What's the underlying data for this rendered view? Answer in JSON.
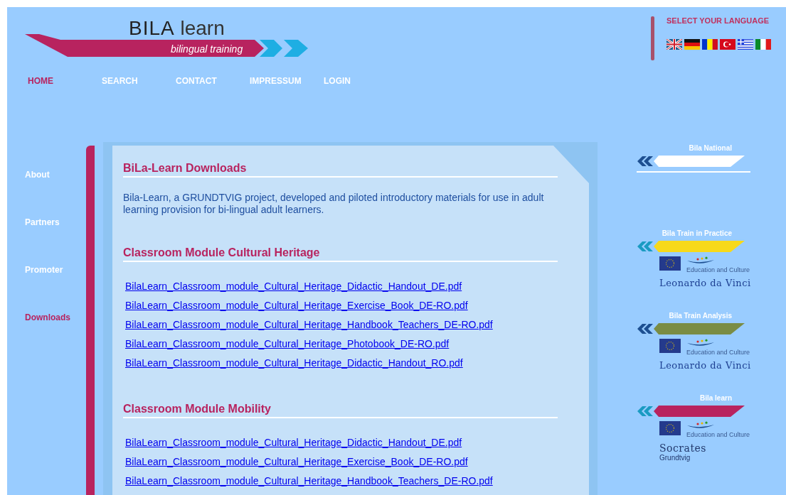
{
  "logo": {
    "title_bold": "BILA",
    "title_light": "learn",
    "tagline": "bilingual training"
  },
  "nav": [
    {
      "label": "HOME",
      "selected": true
    },
    {
      "label": "SEARCH",
      "selected": false
    },
    {
      "label": "CONTACT",
      "selected": false
    },
    {
      "label": "IMPRESSUM",
      "selected": false
    },
    {
      "label": "LOGIN",
      "selected": false
    }
  ],
  "language": {
    "title": "SELECT YOUR LANGUAGE"
  },
  "sidebar": {
    "items": [
      {
        "label": "About",
        "selected": false
      },
      {
        "label": "Partners",
        "selected": false
      },
      {
        "label": "Promoter",
        "selected": false
      },
      {
        "label": "Downloads",
        "selected": true
      }
    ]
  },
  "content": {
    "title": "BiLa-Learn Downloads",
    "intro": "Bila-Learn, a GRUNDTVIG project, developed and piloted introductory materials for use in adult learning provision for bi-lingual adult learners.",
    "sections": [
      {
        "title": "Classroom Module Cultural Heritage",
        "links": [
          "BilaLearn_Classroom_module_Cultural_Heritage_Didactic_Handout_DE.pdf",
          "BilaLearn_Classroom_module_Cultural_Heritage_Exercise_Book_DE-RO.pdf",
          "BilaLearn_Classroom_module_Cultural_Heritage_Handbook_Teachers_DE-RO.pdf",
          "BilaLearn_Classroom_module_Cultural_Heritage_Photobook_DE-RO.pdf",
          "BilaLearn_Classroom_module_Cultural_Heritage_Didactic_Handout_RO.pdf"
        ]
      },
      {
        "title": "Classroom Module Mobility",
        "links": [
          "BilaLearn_Classroom_module_Cultural_Heritage_Didactic_Handout_DE.pdf",
          "BilaLearn_Classroom_module_Cultural_Heritage_Exercise_Book_DE-RO.pdf",
          "BilaLearn_Classroom_module_Cultural_Heritage_Handbook_Teachers_DE-RO.pdf"
        ]
      }
    ]
  },
  "projects": [
    {
      "label": "Bila National",
      "color": "#ffffff"
    },
    {
      "label": "Bila Train in Practice",
      "color": "#f7d91a",
      "programme": {
        "caption": "Education and Culture",
        "name": "Leonardo da Vinci"
      }
    },
    {
      "label": "Bila Train Analysis",
      "color": "#7a8c44",
      "programme": {
        "caption": "Education and Culture",
        "name": "Leonardo da Vinci"
      }
    },
    {
      "label": "Bila learn",
      "color": "#b8235f",
      "programme": {
        "caption": "Education and Culture",
        "name": "Socrates",
        "subname": "Grundtvig"
      }
    }
  ]
}
